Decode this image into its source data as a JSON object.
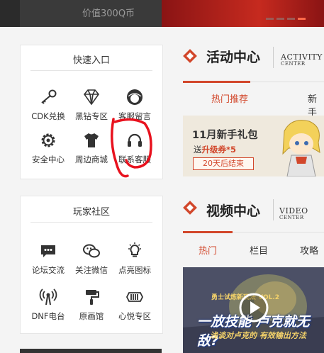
{
  "banner": {
    "subtitle": "价值300Q币",
    "dots": 4
  },
  "quick_entry": {
    "title": "快速入口",
    "items": [
      {
        "label": "CDK兑换",
        "icon": "key-icon"
      },
      {
        "label": "黑钻专区",
        "icon": "diamond-icon"
      },
      {
        "label": "客服留言",
        "icon": "service-avatar-icon"
      },
      {
        "label": "安全中心",
        "icon": "gear-icon"
      },
      {
        "label": "周边商城",
        "icon": "tshirt-icon"
      },
      {
        "label": "联系客服",
        "icon": "headphones-icon"
      }
    ]
  },
  "community": {
    "title": "玩家社区",
    "items": [
      {
        "label": "论坛交流",
        "icon": "chat-bubble-icon"
      },
      {
        "label": "关注微信",
        "icon": "wechat-icon"
      },
      {
        "label": "点亮图标",
        "icon": "lightbulb-icon"
      },
      {
        "label": "DNF电台",
        "icon": "radio-tower-icon"
      },
      {
        "label": "原画馆",
        "icon": "paint-roller-icon"
      },
      {
        "label": "心悦专区",
        "icon": "vip-badge-icon"
      }
    ]
  },
  "activity": {
    "title": "活动中心",
    "en_1": "ACTIVITY",
    "en_2": "CENTER",
    "tabs": [
      "热门推荐",
      "新手"
    ],
    "promo": {
      "title": "11月新手礼包",
      "line_prefix": "送",
      "line_highlight": "升级券*5",
      "countdown": "20天后结束"
    }
  },
  "videos": {
    "title": "视频中心",
    "en_1": "VIDEO",
    "en_2": "CENTER",
    "tabs": [
      "热门",
      "栏目",
      "攻略"
    ],
    "thumb": {
      "tag": "勇士试炼新玩法 VOL.2",
      "headline": "一放技能 卢克就无敌?",
      "caption": "浅谈对卢克的 有效输出方法"
    }
  },
  "colors": {
    "accent": "#d2472b",
    "annotation": "#e8121e"
  }
}
